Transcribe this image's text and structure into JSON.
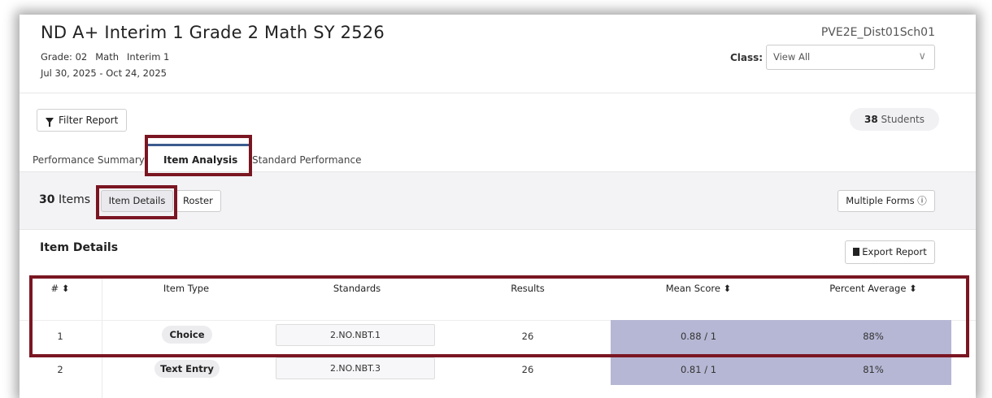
{
  "header": {
    "title": "ND A+ Interim 1 Grade 2 Math SY 2526",
    "grade": "Grade: 02",
    "subject": "Math",
    "assessment": "Interim 1",
    "date_range": "Jul 30, 2025 - Oct 24, 2025",
    "school": "PVE2E_Dist01Sch01",
    "class_label": "Class:",
    "class_value": "View All"
  },
  "toolbar": {
    "filter_label": "Filter Report",
    "student_count": "38",
    "student_label": "Students"
  },
  "tabs": [
    {
      "label": "Performance Summary",
      "active": false
    },
    {
      "label": "Item Analysis",
      "active": true
    },
    {
      "label": "Standard Performance",
      "active": false
    }
  ],
  "subbar": {
    "items_count": "30",
    "items_label": "Items",
    "details_label": "Item Details",
    "roster_label": "Roster",
    "forms_label": "Multiple Forms ⓘ"
  },
  "section": {
    "title": "Item Details",
    "export_label": "Export Report"
  },
  "table": {
    "headers": [
      "# ⬍",
      "Item Type",
      "Standards",
      "Results",
      "Mean Score ⬍",
      "Percent Average ⬍"
    ],
    "rows": [
      {
        "num": "1",
        "type": "Choice",
        "standard": "2.NO.NBT.1",
        "results": "26",
        "mean": "0.88 / 1",
        "percent": "88%"
      },
      {
        "num": "2",
        "type": "Text Entry",
        "standard": "2.NO.NBT.3",
        "results": "26",
        "mean": "0.81 / 1",
        "percent": "81%"
      }
    ]
  },
  "colors": {
    "annotation": "#7a1622",
    "tab_accent": "#3b5b8e",
    "score_shade": "#b6b7d4"
  }
}
